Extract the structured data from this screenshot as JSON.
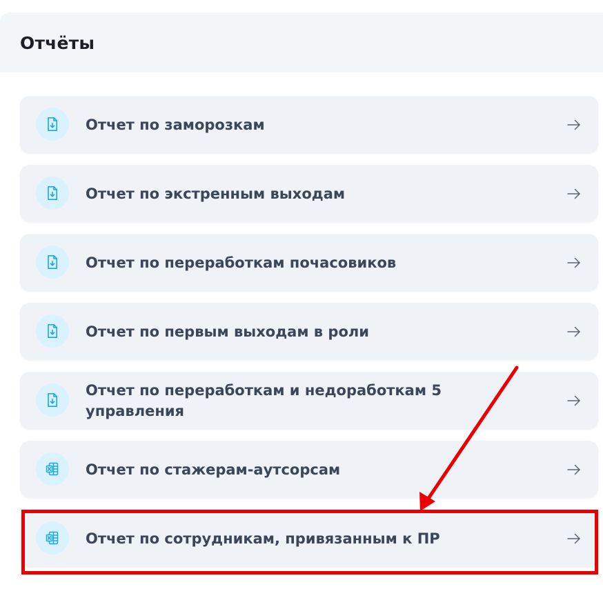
{
  "header": {
    "title": "Отчёты"
  },
  "reports": [
    {
      "label": "Отчет по заморозкам",
      "icon": "file-download-icon"
    },
    {
      "label": "Отчет по экстренным выходам",
      "icon": "file-download-icon"
    },
    {
      "label": "Отчет по переработкам почасовиков",
      "icon": "file-download-icon"
    },
    {
      "label": "Отчет по первым выходам в роли",
      "icon": "file-download-icon"
    },
    {
      "label": "Отчет по переработкам и недоработкам 5 управления",
      "icon": "file-download-icon"
    },
    {
      "label": "Отчет по стажерам-аутсорсам",
      "icon": "excel-file-icon"
    },
    {
      "label": "Отчет по сотрудникам, привязанным к ПР",
      "icon": "excel-file-icon"
    }
  ],
  "colors": {
    "accent": "#1aa6e6",
    "icon_background": "#d9f2fd",
    "card_background": "#eff3f8",
    "header_background": "#f3f6f9",
    "label_text": "#3b4656",
    "annotation": "#ea0000"
  },
  "annotation": {
    "highlighted_item": "Отчет по сотрудникам, привязанным к ПР"
  }
}
